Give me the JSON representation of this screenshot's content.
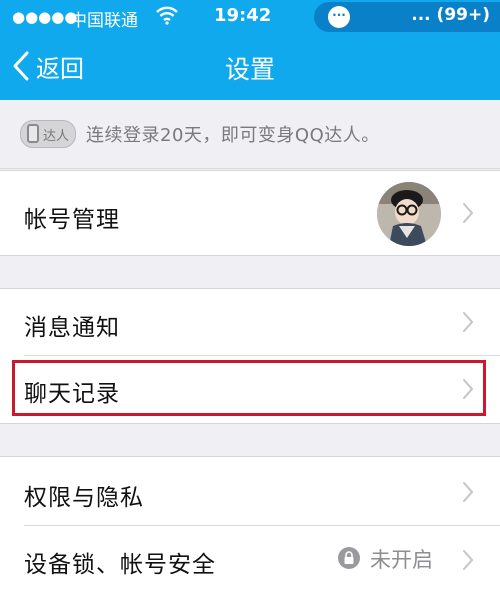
{
  "status_bar": {
    "signal_dots": "●●●●●",
    "carrier": "中国联通",
    "time": "19:42",
    "notification_count": "... (99+)"
  },
  "nav": {
    "back_label": "返回",
    "title": "设置"
  },
  "banner": {
    "badge_text": "达人",
    "message": "连续登录20天，即可变身QQ达人。"
  },
  "settings": {
    "account": {
      "label": "帐号管理"
    },
    "notifications": {
      "label": "消息通知"
    },
    "chat_history": {
      "label": "聊天记录"
    },
    "privacy": {
      "label": "权限与隐私"
    },
    "device_lock": {
      "label": "设备锁、帐号安全",
      "status": "未开启"
    }
  },
  "colors": {
    "brand_blue": "#11a9ee",
    "highlight_red": "#c8192e"
  },
  "icons": [
    "wifi-icon",
    "message-bubble-icon",
    "back-chevron-icon",
    "qq-badge-icon",
    "chevron-right-icon",
    "lock-icon"
  ]
}
